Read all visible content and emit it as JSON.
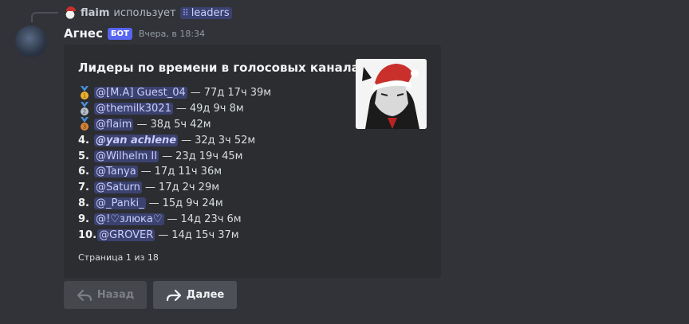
{
  "reply": {
    "username": "flaim",
    "verb": "использует",
    "command": "leaders"
  },
  "message": {
    "username": "Агнес",
    "bot_tag": "БОТ",
    "timestamp": "Вчера, в 18:34"
  },
  "embed": {
    "title": "Лидеры по времени в голосовых каналах",
    "entries": [
      {
        "rank": "",
        "medal": "gold",
        "medal_number": "1",
        "user": "@[M.A] Guest_04",
        "sep": "—",
        "time": "77д 17ч 39м"
      },
      {
        "rank": "",
        "medal": "silver",
        "medal_number": "2",
        "user": "@themilk3021",
        "sep": "—",
        "time": "49д 9ч 8м"
      },
      {
        "rank": "",
        "medal": "bronze",
        "medal_number": "3",
        "user": "@flaim",
        "sep": "—",
        "time": "38д 5ч 42м"
      },
      {
        "rank": "4.",
        "medal": "",
        "user": "@yan achlene",
        "sep": "—",
        "time": "32д 3ч 52м"
      },
      {
        "rank": "5.",
        "medal": "",
        "user": "@Wilhelm II",
        "sep": "—",
        "time": "23д 19ч 45м"
      },
      {
        "rank": "6.",
        "medal": "",
        "user": "@Tanya",
        "sep": "—",
        "time": "17д 11ч 36м"
      },
      {
        "rank": "7.",
        "medal": "",
        "user": "@Saturn",
        "sep": "—",
        "time": "17д 2ч 29м"
      },
      {
        "rank": "8.",
        "medal": "",
        "user": "@_Panki_",
        "sep": "—",
        "time": "15д 9ч 24м"
      },
      {
        "rank": "9.",
        "medal": "",
        "user": "@!♡злюка♡",
        "sep": "—",
        "time": "14д 23ч 6м"
      },
      {
        "rank": "10.",
        "medal": "",
        "user": "@GROVER",
        "sep": "—",
        "time": "14д 15ч 37м"
      }
    ],
    "footer": "Страница 1 из 18"
  },
  "buttons": {
    "back_label": "Назад",
    "next_label": "Далее"
  },
  "colors": {
    "background": "#313338",
    "embed": "#2b2d31",
    "mention": "#3c4270",
    "bot_tag": "#5865f2",
    "gold": "#f0b232",
    "silver": "#b9c1cc",
    "bronze": "#d9843b",
    "ribbon": "#4a8fd8"
  },
  "icons": {
    "command": "slash-command-icon",
    "back": "reply-arrow-icon",
    "next": "forward-arrow-icon"
  }
}
